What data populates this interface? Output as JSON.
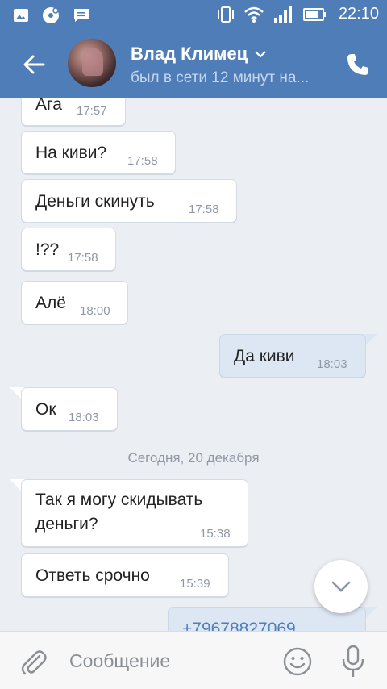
{
  "status_bar": {
    "time": "22:10",
    "icons": [
      "image-icon",
      "media-icon",
      "message-icon",
      "vibrate-icon",
      "wifi-icon",
      "signal-icon",
      "battery-icon"
    ]
  },
  "header": {
    "name": "Влад Климец",
    "status": "был в сети 12 минут на..."
  },
  "messages": [
    {
      "text": "Ага",
      "time": "17:57",
      "dir": "in"
    },
    {
      "text": "На киви?",
      "time": "17:58",
      "dir": "in"
    },
    {
      "text": "Деньги скинуть",
      "time": "17:58",
      "dir": "in"
    },
    {
      "text": "!??",
      "time": "17:58",
      "dir": "in"
    },
    {
      "text": "Алё",
      "time": "18:00",
      "dir": "in"
    },
    {
      "text": "Да киви",
      "time": "18:03",
      "dir": "out"
    },
    {
      "text": "Ок",
      "time": "18:03",
      "dir": "in"
    },
    {
      "text_line1": "Так я могу скидывать",
      "text_line2": "деньги?",
      "time": "15:38",
      "dir": "in"
    },
    {
      "text": "Ответь срочно",
      "time": "15:39",
      "dir": "in"
    },
    {
      "text": "+79678827069",
      "time": "",
      "dir": "out"
    }
  ],
  "date_separator": "Сегодня, 20 декабря",
  "composer": {
    "placeholder": "Сообщение"
  },
  "colors": {
    "header": "#4f7db8",
    "background": "#ebeef2",
    "outgoing_bubble": "#dce7f3",
    "link": "#4f7db8"
  }
}
